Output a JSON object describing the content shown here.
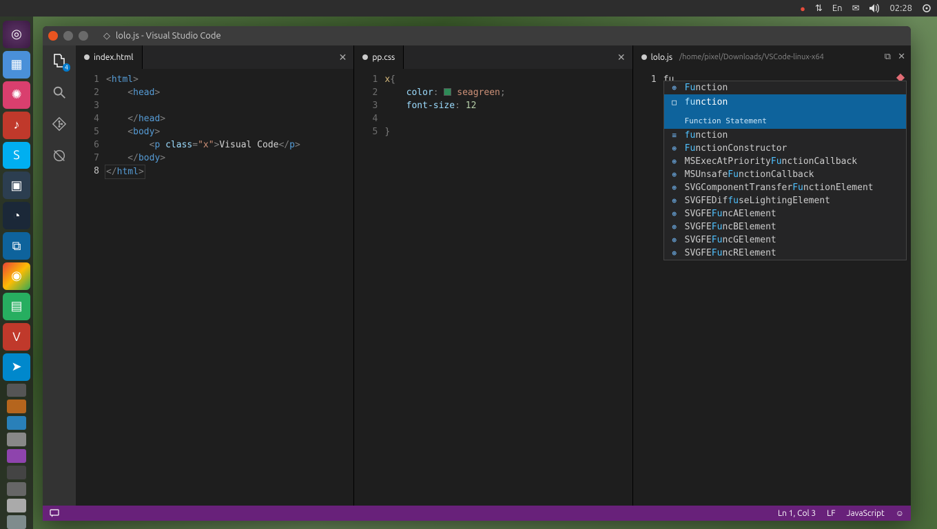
{
  "panel": {
    "lang": "En",
    "time": "02:28"
  },
  "window": {
    "title": "lolo.js - Visual Studio Code"
  },
  "activity": {
    "explorer_badge": "4"
  },
  "panes": [
    {
      "tab": {
        "label": "index.html",
        "modified": true
      },
      "lines": [
        "1",
        "2",
        "3",
        "4",
        "5",
        "6",
        "7",
        "8"
      ],
      "html": {
        "l1a": "<",
        "l1b": "html",
        "l1c": ">",
        "l2a": "    <",
        "l2b": "head",
        "l2c": ">",
        "l4a": "    </",
        "l4b": "head",
        "l4c": ">",
        "l5a": "    <",
        "l5b": "body",
        "l5c": ">",
        "l6a": "        <",
        "l6b": "p",
        "l6sp": " ",
        "l6attr": "class",
        "l6eq": "=",
        "l6q": "\"",
        "l6v": "x",
        "l6d": ">",
        "l6txt": "Visual Code",
        "l6e": "</",
        "l6f": "p",
        "l6g": ">",
        "l7a": "    </",
        "l7b": "body",
        "l7c": ">",
        "l8a": "</",
        "l8b": "html",
        "l8c": ">"
      }
    },
    {
      "tab": {
        "label": "pp.css",
        "modified": true
      },
      "lines": [
        "1",
        "2",
        "3",
        "4",
        "5"
      ],
      "css": {
        "l1a": "x",
        "l1b": "{",
        "l2a": "    ",
        "l2b": "color",
        "l2c": ": ",
        "l2d": "seagreen",
        "l2e": ";",
        "l3a": "    ",
        "l3b": "font-size",
        "l3c": ": ",
        "l3d": "12",
        "l5a": "}"
      }
    },
    {
      "tab": {
        "label": "lolo.js",
        "modified": true,
        "path": "/home/pixel/Downloads/VSCode-linux-x64"
      },
      "lines": [
        "1"
      ],
      "typed": "fu",
      "suggestions": [
        {
          "icon": "⊕",
          "pre": "Fu",
          "rest": "nction"
        },
        {
          "icon": "□",
          "pre": "fu",
          "rest": "nction",
          "detail": "Function Statement",
          "selected": true
        },
        {
          "icon": "≡",
          "pre": "fu",
          "rest": "nction"
        },
        {
          "icon": "⊕",
          "pre": "Fu",
          "rest": "nctionConstructor"
        },
        {
          "icon": "⊕",
          "prefix": "MSExecAtPriority",
          "pre": "Fu",
          "rest": "nctionCallback"
        },
        {
          "icon": "⊕",
          "prefix": "MSUnsafe",
          "pre": "Fu",
          "rest": "nctionCallback"
        },
        {
          "icon": "⊕",
          "prefix": "SVGComponentTransfer",
          "pre": "Fu",
          "rest": "nctionElement"
        },
        {
          "icon": "⊕",
          "prefix": "SVGFEDif",
          "pre": "fu",
          "rest": "seLightingElement"
        },
        {
          "icon": "⊕",
          "prefix": "SVGFE",
          "pre": "Fu",
          "rest": "ncAElement"
        },
        {
          "icon": "⊕",
          "prefix": "SVGFE",
          "pre": "Fu",
          "rest": "ncBElement"
        },
        {
          "icon": "⊕",
          "prefix": "SVGFE",
          "pre": "Fu",
          "rest": "ncGElement"
        },
        {
          "icon": "⊕",
          "prefix": "SVGFE",
          "pre": "Fu",
          "rest": "ncRElement"
        }
      ]
    }
  ],
  "status": {
    "pos": "Ln 1, Col 3",
    "eol": "LF",
    "lang": "JavaScript"
  }
}
